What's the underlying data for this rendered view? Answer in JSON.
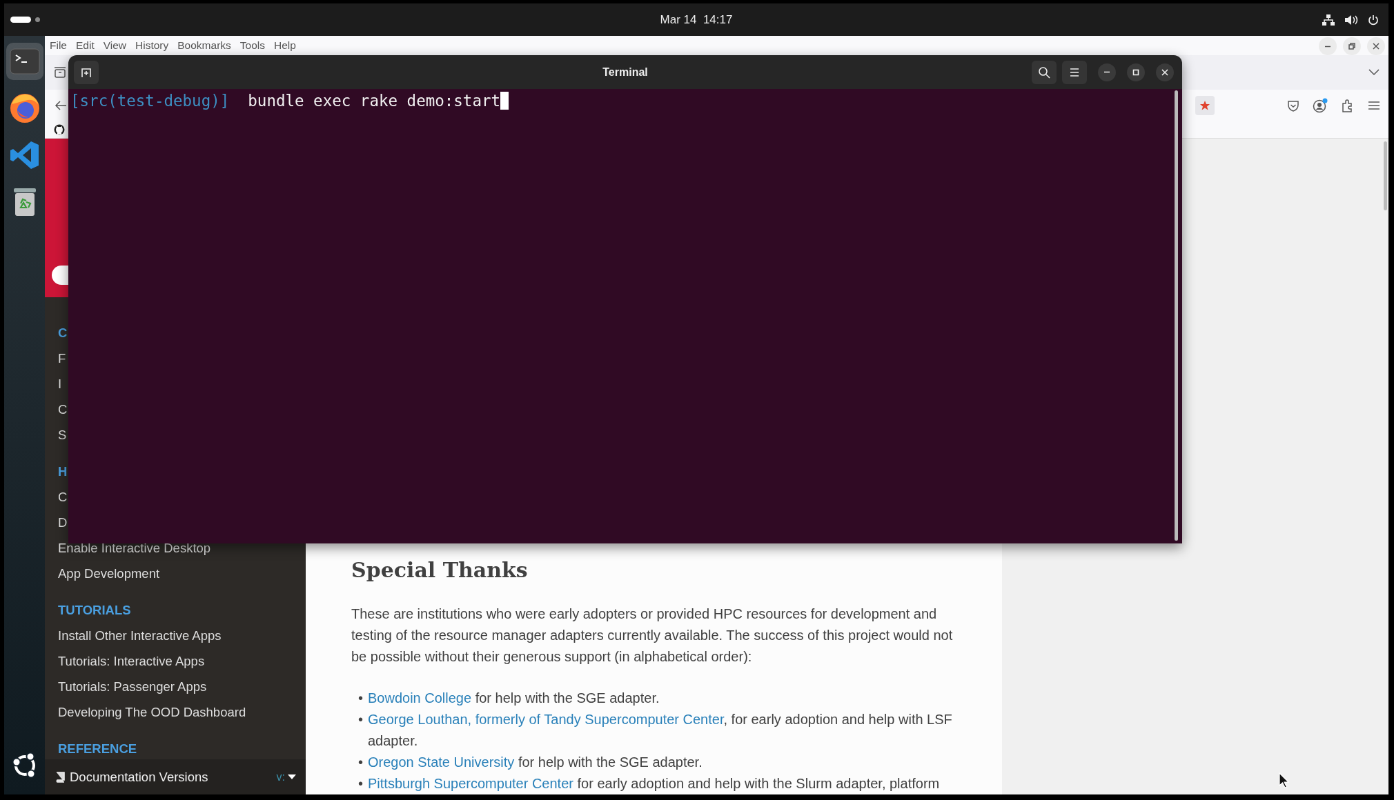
{
  "top_bar": {
    "clock": "Mar 14  14:17",
    "workspaces": [
      {
        "selected": true
      },
      {
        "selected": false
      }
    ]
  },
  "dock": {
    "apps": [
      {
        "kind": "terminal",
        "selected": true
      },
      {
        "kind": "firefox",
        "selected": false
      },
      {
        "kind": "vscode",
        "selected": false
      },
      {
        "kind": "trash",
        "selected": false
      }
    ]
  },
  "browser": {
    "menu": [
      "File",
      "Edit",
      "View",
      "History",
      "Bookmarks",
      "Tools",
      "Help"
    ],
    "sidebar": {
      "items": [
        {
          "kind": "heading",
          "text": "C"
        },
        {
          "kind": "link",
          "text": "F"
        },
        {
          "kind": "link",
          "text": "I"
        },
        {
          "kind": "link",
          "text": "C"
        },
        {
          "kind": "link",
          "text": "S"
        },
        {
          "kind": "heading",
          "text": "H"
        },
        {
          "kind": "link",
          "text": "C"
        },
        {
          "kind": "link",
          "text": "D"
        },
        {
          "kind": "link",
          "text": "Enable Interactive Desktop"
        },
        {
          "kind": "link",
          "text": "App Development"
        },
        {
          "kind": "heading",
          "text": "TUTORIALS"
        },
        {
          "kind": "link",
          "text": "Install Other Interactive Apps"
        },
        {
          "kind": "link",
          "text": "Tutorials: Interactive Apps"
        },
        {
          "kind": "link",
          "text": "Tutorials: Passenger Apps"
        },
        {
          "kind": "link",
          "text": "Developing The OOD Dashboard"
        },
        {
          "kind": "heading",
          "text": "REFERENCE"
        }
      ],
      "footer": {
        "label": "Documentation Versions",
        "version": "v:"
      }
    },
    "content": {
      "heading": "Special Thanks",
      "paragraph": "These are institutions who were early adopters or provided HPC resources for development and testing of the resource manager adapters currently available. The success of this project would not be possible without their generous support (in alphabetical order):",
      "list": [
        {
          "bullet": "•",
          "link": "Bowdoin College",
          "text": " for help with the SGE adapter."
        },
        {
          "bullet": "•",
          "link": "George Louthan, formerly of Tandy Supercomputer Center",
          "text": ", for early adoption and help with LSF adapter."
        },
        {
          "bullet": "•",
          "link": "Oregon State University",
          "text": " for help with the SGE adapter."
        },
        {
          "bullet": "•",
          "link": "Pittsburgh Supercomputer Center",
          "text": " for early adoption and help with the Slurm adapter, platform"
        }
      ]
    }
  },
  "terminal": {
    "title": "Terminal",
    "prompt": "[src(test-debug)]",
    "command": "bundle exec rake demo:start"
  }
}
